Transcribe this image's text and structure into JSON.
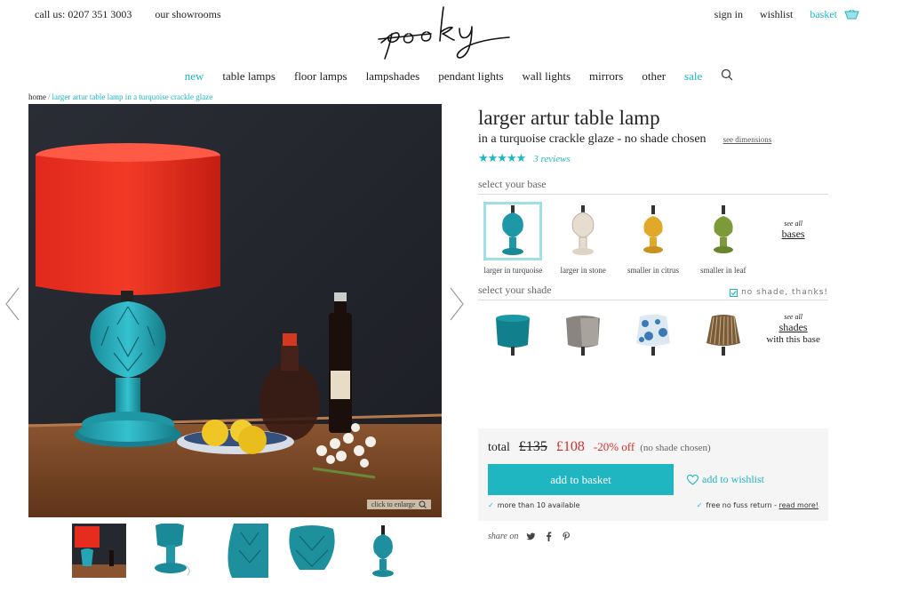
{
  "topbar": {
    "phone": "call us: 0207 351 3003",
    "showrooms": "our showrooms",
    "sign_in": "sign in",
    "wishlist": "wishlist",
    "basket": "basket"
  },
  "brand": {
    "logo_text": "pooky",
    "accent_color": "#1fb6c1",
    "sale_color": "#d0312d"
  },
  "nav": {
    "items": [
      "new",
      "table lamps",
      "floor lamps",
      "lampshades",
      "pendant lights",
      "wall lights",
      "mirrors",
      "other",
      "sale"
    ],
    "search_icon": "search-icon"
  },
  "breadcrumb": {
    "home": "home",
    "separator": "/",
    "current": "larger artur table lamp in a turquoise crackle glaze"
  },
  "gallery": {
    "enlarge_label": "click to enlarge",
    "thumbnail_count": 5
  },
  "product": {
    "title": "larger artur table lamp",
    "subtitle": "in a turquoise crackle glaze - no shade chosen",
    "see_dimensions": "see dimensions",
    "rating": 5,
    "stars": "★★★★★",
    "reviews": "3 reviews"
  },
  "bases": {
    "label": "select your base",
    "options": [
      "larger in turquoise",
      "larger in stone",
      "smaller in citrus",
      "smaller in leaf"
    ],
    "selected": "larger in turquoise",
    "see_all_small": "see all",
    "see_all_big": "bases"
  },
  "shades": {
    "label": "select your shade",
    "no_shade": "no shade, thanks!",
    "see_all_small": "see all",
    "see_all_big": "shades",
    "see_all_extra": "with this base"
  },
  "price": {
    "total_label": "total",
    "was": "£135",
    "now": "£108",
    "discount": "-20% off",
    "note": "(no shade chosen)",
    "add_to_basket": "add to basket",
    "add_to_wishlist": "add to wishlist",
    "stock": "more than 10 available",
    "returns": "free no fuss return - ",
    "read_more": "read more!"
  },
  "share": {
    "label": "share on",
    "icons": [
      "twitter-icon",
      "facebook-icon",
      "pinterest-icon"
    ]
  }
}
